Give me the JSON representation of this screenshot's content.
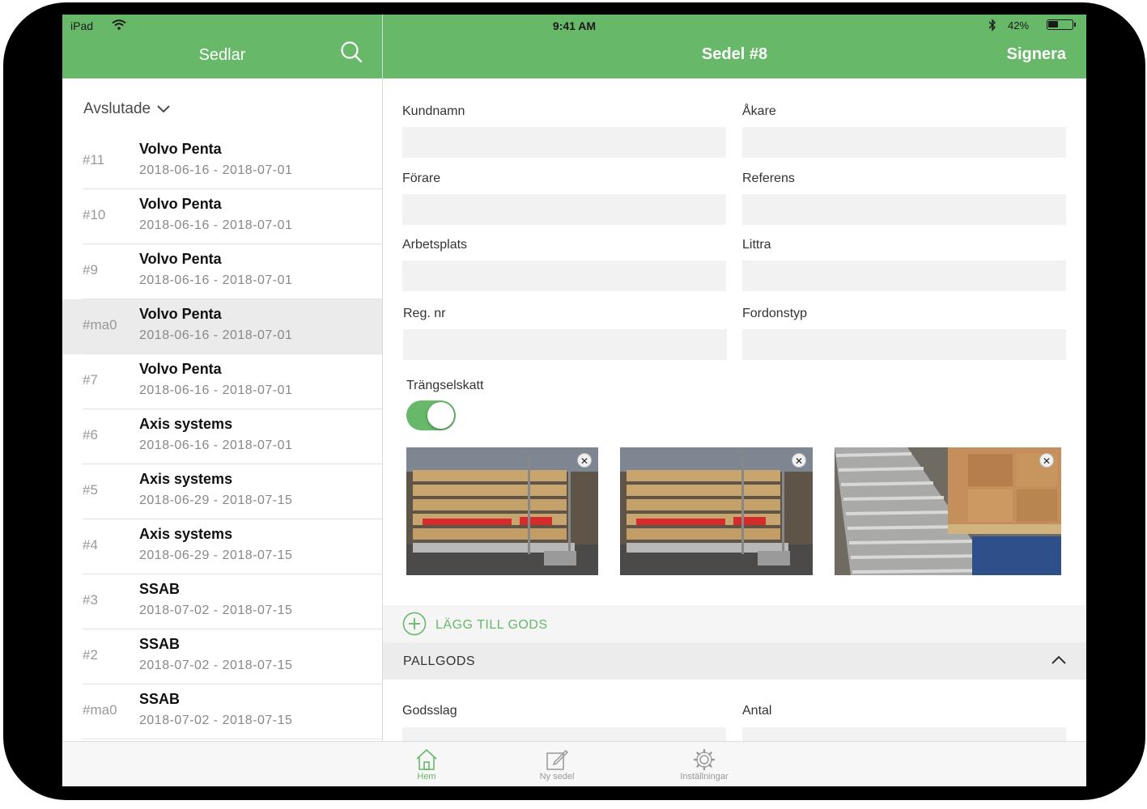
{
  "status": {
    "carrier": "iPad",
    "time": "9:41 AM",
    "battery_percent_text": "42%",
    "battery_level": 0.42
  },
  "colors": {
    "accent": "#67b868",
    "bezel": "#000000"
  },
  "header": {
    "left_title": "Sedlar",
    "right_title": "Sedel #8",
    "sign_label": "Signera",
    "search_icon": "search-icon"
  },
  "sidebar": {
    "section_label": "Avslutade",
    "items": [
      {
        "num": "#11",
        "name": "Volvo Penta",
        "dates": "2018-06-16 - 2018-07-01"
      },
      {
        "num": "#10",
        "name": "Volvo Penta",
        "dates": "2018-06-16 - 2018-07-01"
      },
      {
        "num": "#9",
        "name": "Volvo Penta",
        "dates": "2018-06-16 - 2018-07-01"
      },
      {
        "num": "#ma0",
        "name": "Volvo Penta",
        "dates": "2018-06-16 - 2018-07-01",
        "selected": true
      },
      {
        "num": "#7",
        "name": "Volvo Penta",
        "dates": "2018-06-16 - 2018-07-01"
      },
      {
        "num": "#6",
        "name": "Axis systems",
        "dates": "2018-06-16 - 2018-07-01"
      },
      {
        "num": "#5",
        "name": "Axis systems",
        "dates": "2018-06-29 - 2018-07-15"
      },
      {
        "num": "#4",
        "name": "Axis systems",
        "dates": "2018-06-29 - 2018-07-15"
      },
      {
        "num": "#3",
        "name": "SSAB",
        "dates": "2018-07-02 - 2018-07-15"
      },
      {
        "num": "#2",
        "name": "SSAB",
        "dates": "2018-07-02 - 2018-07-15"
      },
      {
        "num": "#ma0",
        "name": "SSAB",
        "dates": "2018-07-02 - 2018-07-15"
      }
    ]
  },
  "form": {
    "kundnamn": {
      "label": "Kundnamn",
      "value": ""
    },
    "akare": {
      "label": "Åkare",
      "value": ""
    },
    "forare": {
      "label": "Förare",
      "value": ""
    },
    "referens": {
      "label": "Referens",
      "value": ""
    },
    "arbetsplats": {
      "label": "Arbetsplats",
      "value": ""
    },
    "littra": {
      "label": "Littra",
      "value": ""
    },
    "regnr": {
      "label": "Reg. nr",
      "value": ""
    },
    "fordonstyp": {
      "label": "Fordonstyp",
      "value": ""
    },
    "trangselskatt": {
      "label": "Trängselskatt",
      "on": true
    }
  },
  "photos": [
    {
      "subject": "stacked wooden pallets with metal crates"
    },
    {
      "subject": "stacked wooden pallets with metal crates"
    },
    {
      "subject": "roller conveyor with cardboard boxes"
    }
  ],
  "add_goods_label": "LÄGG TILL GODS",
  "group": {
    "label": "PALLGODS",
    "expanded": true
  },
  "goods": {
    "godsslag": {
      "label": "Godsslag",
      "value": ""
    },
    "antal": {
      "label": "Antal",
      "value": ""
    }
  },
  "tabs": [
    {
      "label": "Hem",
      "icon": "home-icon",
      "active": true
    },
    {
      "label": "Ny sedel",
      "icon": "edit-icon",
      "active": false
    },
    {
      "label": "Inställningar",
      "icon": "gear-icon",
      "active": false
    }
  ]
}
